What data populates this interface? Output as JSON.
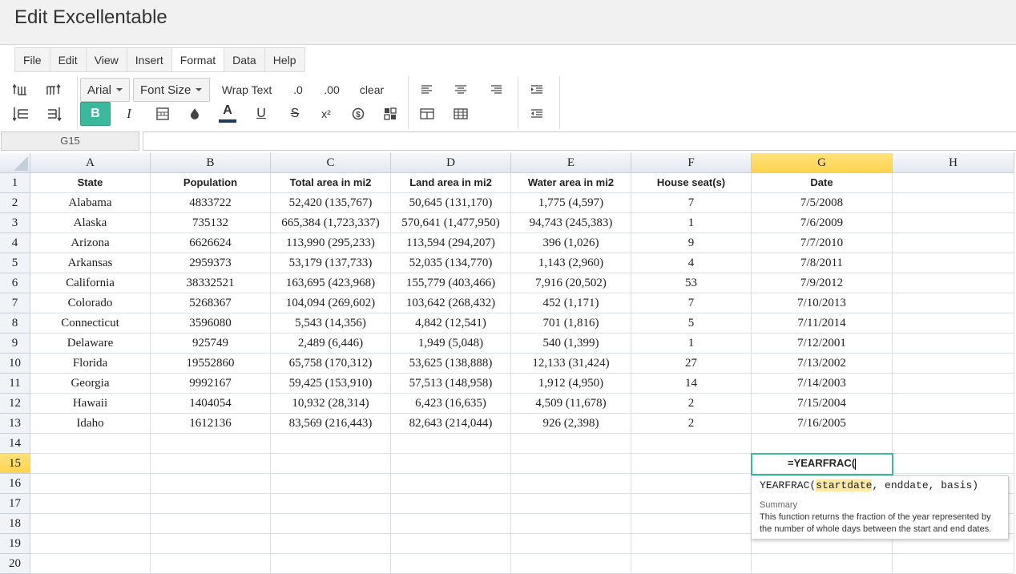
{
  "app": {
    "title": "Edit Excellentable"
  },
  "menus": [
    {
      "label": "File",
      "active": false
    },
    {
      "label": "Edit",
      "active": false
    },
    {
      "label": "View",
      "active": false
    },
    {
      "label": "Insert",
      "active": false
    },
    {
      "label": "Format",
      "active": true
    },
    {
      "label": "Data",
      "active": false
    },
    {
      "label": "Help",
      "active": false
    }
  ],
  "toolbar": {
    "font_family": "Arial",
    "font_size": "Font Size",
    "wrap_text": "Wrap Text",
    "decrease_decimal": ".0",
    "increase_decimal": ".00",
    "clear": "clear",
    "bold": "B",
    "italic": "I",
    "font_color_letter": "A",
    "underline_letter": "U",
    "strike_letter": "S",
    "superscript": "x²",
    "accent_color": "#3cb89c"
  },
  "formula_bar": {
    "cell_ref": "G15",
    "value": ""
  },
  "columns": [
    "A",
    "B",
    "C",
    "D",
    "E",
    "F",
    "G",
    "H"
  ],
  "selected_column": "G",
  "selected_row": "15",
  "rows": [
    {
      "num": "1",
      "cells": [
        "State",
        "Population",
        "Total area in mi2",
        "Land area in mi2",
        "Water area in mi2",
        "House seat(s)",
        "Date",
        ""
      ]
    },
    {
      "num": "2",
      "cells": [
        "Alabama",
        "4833722",
        "52,420 (135,767)",
        "50,645 (131,170)",
        "1,775 (4,597)",
        "7",
        "7/5/2008",
        ""
      ]
    },
    {
      "num": "3",
      "cells": [
        "Alaska",
        "735132",
        "665,384 (1,723,337)",
        "570,641 (1,477,950)",
        "94,743 (245,383)",
        "1",
        "7/6/2009",
        ""
      ]
    },
    {
      "num": "4",
      "cells": [
        "Arizona",
        "6626624",
        "113,990 (295,233)",
        "113,594 (294,207)",
        "396 (1,026)",
        "9",
        "7/7/2010",
        ""
      ]
    },
    {
      "num": "5",
      "cells": [
        "Arkansas",
        "2959373",
        "53,179 (137,733)",
        "52,035 (134,770)",
        "1,143 (2,960)",
        "4",
        "7/8/2011",
        ""
      ]
    },
    {
      "num": "6",
      "cells": [
        "California",
        "38332521",
        "163,695 (423,968)",
        "155,779 (403,466)",
        "7,916 (20,502)",
        "53",
        "7/9/2012",
        ""
      ]
    },
    {
      "num": "7",
      "cells": [
        "Colorado",
        "5268367",
        "104,094 (269,602)",
        "103,642 (268,432)",
        "452 (1,171)",
        "7",
        "7/10/2013",
        ""
      ]
    },
    {
      "num": "8",
      "cells": [
        "Connecticut",
        "3596080",
        "5,543 (14,356)",
        "4,842 (12,541)",
        "701 (1,816)",
        "5",
        "7/11/2014",
        ""
      ]
    },
    {
      "num": "9",
      "cells": [
        "Delaware",
        "925749",
        "2,489 (6,446)",
        "1,949 (5,048)",
        "540 (1,399)",
        "1",
        "7/12/2001",
        ""
      ]
    },
    {
      "num": "10",
      "cells": [
        "Florida",
        "19552860",
        "65,758 (170,312)",
        "53,625 (138,888)",
        "12,133 (31,424)",
        "27",
        "7/13/2002",
        ""
      ]
    },
    {
      "num": "11",
      "cells": [
        "Georgia",
        "9992167",
        "59,425 (153,910)",
        "57,513 (148,958)",
        "1,912 (4,950)",
        "14",
        "7/14/2003",
        ""
      ]
    },
    {
      "num": "12",
      "cells": [
        "Hawaii",
        "1404054",
        "10,932 (28,314)",
        "6,423 (16,635)",
        "4,509 (11,678)",
        "2",
        "7/15/2004",
        ""
      ]
    },
    {
      "num": "13",
      "cells": [
        "Idaho",
        "1612136",
        "83,569 (216,443)",
        "82,643 (214,044)",
        "926 (2,398)",
        "2",
        "7/16/2005",
        ""
      ]
    },
    {
      "num": "14",
      "cells": [
        "",
        "",
        "",
        "",
        "",
        "",
        "",
        ""
      ]
    },
    {
      "num": "15",
      "cells": [
        "",
        "",
        "",
        "",
        "",
        "",
        "",
        ""
      ]
    },
    {
      "num": "16",
      "cells": [
        "",
        "",
        "",
        "",
        "",
        "",
        "",
        ""
      ]
    },
    {
      "num": "17",
      "cells": [
        "",
        "",
        "",
        "",
        "",
        "",
        "",
        ""
      ]
    },
    {
      "num": "18",
      "cells": [
        "",
        "",
        "",
        "",
        "",
        "",
        "",
        ""
      ]
    },
    {
      "num": "19",
      "cells": [
        "",
        "",
        "",
        "",
        "",
        "",
        "",
        ""
      ]
    },
    {
      "num": "20",
      "cells": [
        "",
        "",
        "",
        "",
        "",
        "",
        "",
        ""
      ]
    }
  ],
  "editor": {
    "text": "=YEARFRAC("
  },
  "autocomplete": {
    "fn": "YEARFRAC(",
    "arg_active": "startdate",
    "args_rest": ", enddate, basis)",
    "summary_label": "Summary",
    "summary_text": "This function returns the fraction of the year represented by the number of whole days between the start and end dates."
  }
}
